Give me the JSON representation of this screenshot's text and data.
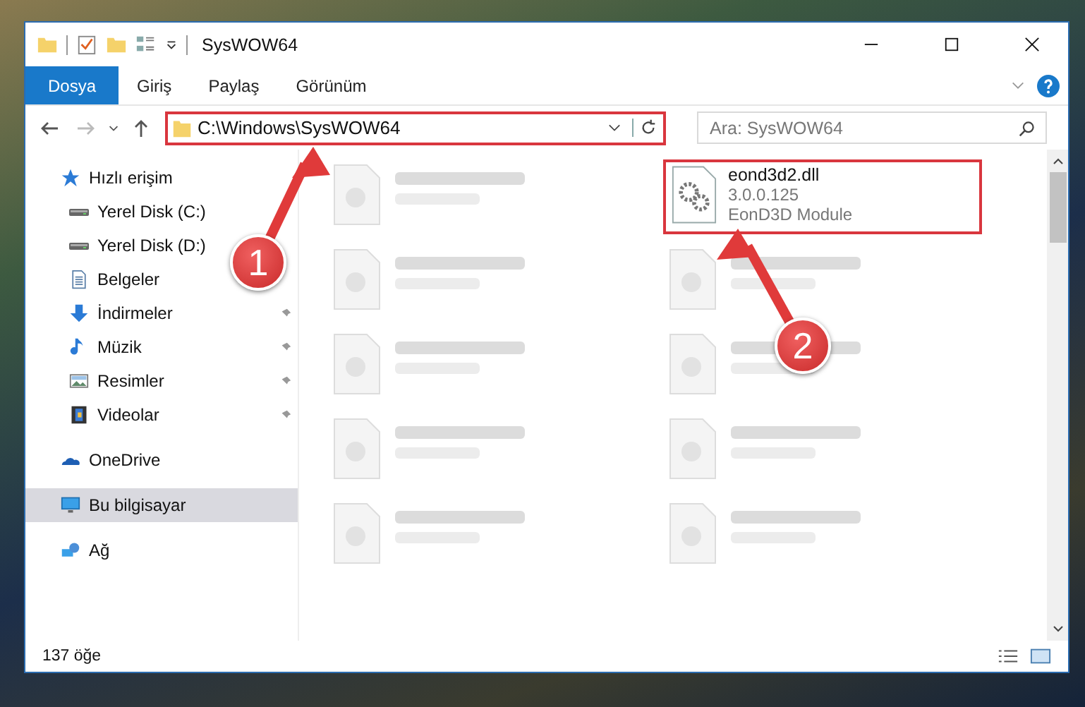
{
  "window": {
    "title": "SysWOW64"
  },
  "ribbon": {
    "tabs": [
      {
        "label": "Dosya",
        "selected": true
      },
      {
        "label": "Giriş",
        "selected": false
      },
      {
        "label": "Paylaş",
        "selected": false
      },
      {
        "label": "Görünüm",
        "selected": false
      }
    ]
  },
  "address_bar": {
    "path": "C:\\Windows\\SysWOW64"
  },
  "search": {
    "placeholder": "Ara: SysWOW64"
  },
  "navigation": [
    {
      "label": "Hızlı erişim",
      "kind": "star",
      "selected": false,
      "children": [
        {
          "label": "Yerel Disk (C:)",
          "kind": "drive",
          "pinned": false,
          "selected": false
        },
        {
          "label": "Yerel Disk (D:)",
          "kind": "drive",
          "pinned": false,
          "selected": false
        },
        {
          "label": "Belgeler",
          "kind": "document",
          "pinned": false,
          "selected": false
        },
        {
          "label": "İndirmeler",
          "kind": "download",
          "pinned": true,
          "selected": false
        },
        {
          "label": "Müzik",
          "kind": "music",
          "pinned": true,
          "selected": false
        },
        {
          "label": "Resimler",
          "kind": "picture",
          "pinned": true,
          "selected": false
        },
        {
          "label": "Videolar",
          "kind": "video",
          "pinned": true,
          "selected": false
        }
      ]
    },
    {
      "label": "OneDrive",
      "kind": "cloud",
      "selected": false
    },
    {
      "label": "Bu bilgisayar",
      "kind": "computer",
      "selected": true
    },
    {
      "label": "Ağ",
      "kind": "network",
      "selected": false
    }
  ],
  "files": [
    {
      "kind": "blurred"
    },
    {
      "kind": "file",
      "name": "eond3d2.dll",
      "lines": [
        "3.0.0.125",
        "EonD3D Module"
      ],
      "highlighted": true
    },
    {
      "kind": "blurred"
    },
    {
      "kind": "blurred"
    },
    {
      "kind": "blurred"
    },
    {
      "kind": "blurred"
    },
    {
      "kind": "blurred"
    },
    {
      "kind": "blurred"
    },
    {
      "kind": "blurred"
    },
    {
      "kind": "blurred"
    }
  ],
  "annotations": [
    {
      "number": "1"
    },
    {
      "number": "2"
    }
  ],
  "status_bar": {
    "item_count": "137 öğe"
  }
}
